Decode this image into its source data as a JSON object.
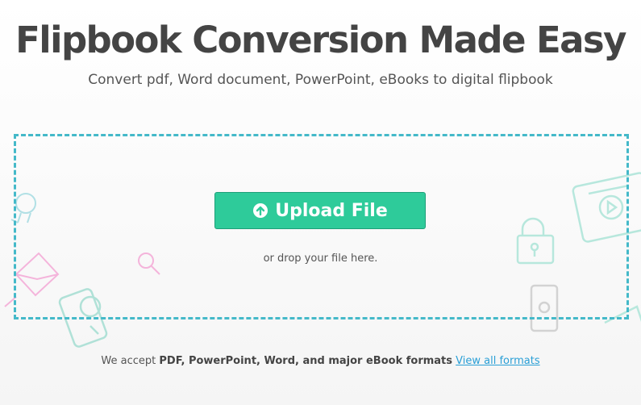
{
  "header": {
    "title": "Flipbook Conversion Made Easy",
    "subtitle": "Convert pdf, Word document, PowerPoint, eBooks to digital flipbook"
  },
  "dropzone": {
    "upload_label": "Upload File",
    "hint": "or drop your file here."
  },
  "footer": {
    "prefix": "We accept",
    "formats": "PDF, PowerPoint, Word, and major eBook formats",
    "link": "View all formats"
  },
  "colors": {
    "accent": "#2ecb9a",
    "dash": "#44b9c9",
    "link": "#2a9fd6"
  },
  "icons": [
    "lightbulb-icon",
    "envelope-icon",
    "magnifier-icon",
    "phone-user-icon",
    "video-card-icon",
    "padlock-icon",
    "mobile-icon",
    "arrow-up-circle-icon"
  ]
}
